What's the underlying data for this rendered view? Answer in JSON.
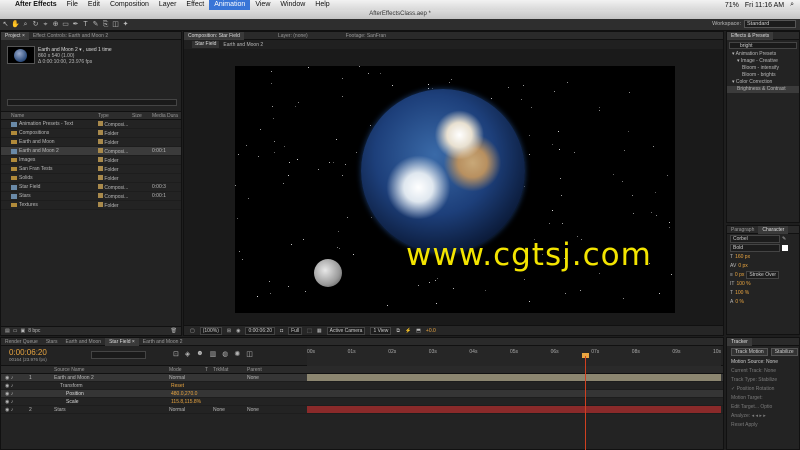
{
  "menubar": {
    "apple": "",
    "app": "After Effects",
    "items": [
      "File",
      "Edit",
      "Composition",
      "Layer",
      "Effect",
      "Animation",
      "View",
      "Window",
      "Help"
    ],
    "active_item": "Animation",
    "status": [
      "71%",
      "Fri 11:16 AM",
      "Q"
    ]
  },
  "window": {
    "title": "AfterEffectsClass.aep *"
  },
  "workspace": {
    "label": "Workspace:",
    "value": "Standard"
  },
  "project": {
    "tabs": [
      "Project ×",
      "Effect Controls: Earth and Moon 2"
    ],
    "item_name": "Earth and Moon 2 ▾ , used 1 time",
    "item_size": "860 x 540 (1.00)",
    "item_duration": "Δ 0:00:10:00, 23.976 fps",
    "columns": [
      "Name",
      "Type",
      "Size",
      "Media Dura"
    ],
    "rows": [
      {
        "name": "Animation Presets - Text",
        "type": "Composi...",
        "size": "",
        "dur": "",
        "icon": "comp",
        "color": "#a98a4c"
      },
      {
        "name": "Compositions",
        "type": "Folder",
        "size": "",
        "dur": "",
        "icon": "folder",
        "color": "#a98a4c"
      },
      {
        "name": "Earth and Moon",
        "type": "Folder",
        "size": "",
        "dur": "",
        "icon": "folder",
        "color": "#a98a4c"
      },
      {
        "name": "Earth and Moon 2",
        "type": "Composi...",
        "size": "",
        "dur": "0:00:1",
        "icon": "comp",
        "color": "#a98a4c",
        "selected": true
      },
      {
        "name": "Images",
        "type": "Folder",
        "size": "",
        "dur": "",
        "icon": "folder",
        "color": "#a98a4c"
      },
      {
        "name": "San Fran Tests",
        "type": "Folder",
        "size": "",
        "dur": "",
        "icon": "folder",
        "color": "#a98a4c"
      },
      {
        "name": "Solids",
        "type": "Folder",
        "size": "",
        "dur": "",
        "icon": "folder",
        "color": "#a98a4c"
      },
      {
        "name": "Star Field",
        "type": "Composi...",
        "size": "",
        "dur": "0:00:3",
        "icon": "comp",
        "color": "#a98a4c"
      },
      {
        "name": "Stars",
        "type": "Composi...",
        "size": "",
        "dur": "0:00:1",
        "icon": "comp",
        "color": "#a98a4c"
      },
      {
        "name": "Textures",
        "type": "Folder",
        "size": "",
        "dur": "",
        "icon": "folder",
        "color": "#a98a4c"
      }
    ],
    "footer_bpc": "8 bpc"
  },
  "viewer": {
    "tabs": [
      "Composition: Star Field",
      "Layer: (none)",
      "Footage: SanFran"
    ],
    "breadcrumbs": [
      "Star Field",
      "Earth and Moon 2"
    ],
    "watermark": "www.cgtsj.com",
    "controls": {
      "zoom": "(100%)",
      "timecode": "0:00:06:20",
      "resolution": "Full",
      "camera": "Active Camera",
      "view": "1 View",
      "exposure": "+0.0"
    }
  },
  "effects": {
    "tab": "Effects & Presets",
    "search": "bright",
    "items": [
      {
        "label": "▾ Animation Presets",
        "indent": 1
      },
      {
        "label": "▾ Image - Creative",
        "indent": 2
      },
      {
        "label": "Bloom - intensify",
        "indent": 3
      },
      {
        "label": "Bloom - brights",
        "indent": 3
      },
      {
        "label": "▾ Color Correction",
        "indent": 1
      },
      {
        "label": "Brightness & Contrast",
        "indent": 2,
        "selected": true
      }
    ]
  },
  "character": {
    "tabs": [
      "Paragraph",
      "Character"
    ],
    "font": "Corbel",
    "style": "Bold",
    "size": "160 px",
    "tracking": "0 px",
    "stroke": "Stroke Over",
    "vscale": "100 %",
    "hscale": "100 %",
    "baseline": "0 px",
    "tsume": "0 %"
  },
  "timeline": {
    "tabs": [
      "Render Queue",
      "Stars",
      "Earth and Moon",
      "Star Field ×",
      "Earth and Moon 2"
    ],
    "current_time": "0:00:06:20",
    "frames": "00164 (23.976 fps)",
    "ruler": [
      "00s",
      "01s",
      "02s",
      "03s",
      "04s",
      "05s",
      "06s",
      "07s",
      "08s",
      "09s",
      "10s"
    ],
    "columns": [
      "Source Name",
      "Mode",
      "T",
      "TrkMat",
      "Parent"
    ],
    "layers": [
      {
        "num": "1",
        "name": "Earth and Moon 2",
        "mode": "Normal",
        "trkmat": "",
        "parent": "None",
        "selected": true,
        "bar": "#8c8670"
      },
      {
        "num": "",
        "name": "Transform",
        "mode": "",
        "trkmat": "",
        "parent": "",
        "value": "Reset",
        "indent": 1
      },
      {
        "num": "",
        "name": "Position",
        "mode": "",
        "trkmat": "",
        "parent": "",
        "value": "480.0,270.0",
        "indent": 2,
        "selected": true
      },
      {
        "num": "",
        "name": "Scale",
        "mode": "",
        "trkmat": "",
        "parent": "",
        "value": "115.8,115.8%",
        "indent": 2
      },
      {
        "num": "2",
        "name": "Stars",
        "mode": "Normal",
        "trkmat": "None",
        "parent": "None",
        "bar": "#8a2a2a"
      }
    ]
  },
  "tracker": {
    "tab": "Tracker",
    "buttons": [
      "Track Motion",
      "Stabilize"
    ],
    "rows": [
      "Motion Source:  None",
      "Current Track:  None",
      "Track Type:  Stabilize",
      "✓ Position   Rotation",
      "Motion Target:",
      "Edit Target...   Optio",
      "Analyze:  ◂ ◂ ▸ ▸",
      "Reset    Apply"
    ]
  },
  "colors": {
    "accent": "#e9a540",
    "watermark": "#f3e400",
    "menu_active": "#3875d7"
  }
}
